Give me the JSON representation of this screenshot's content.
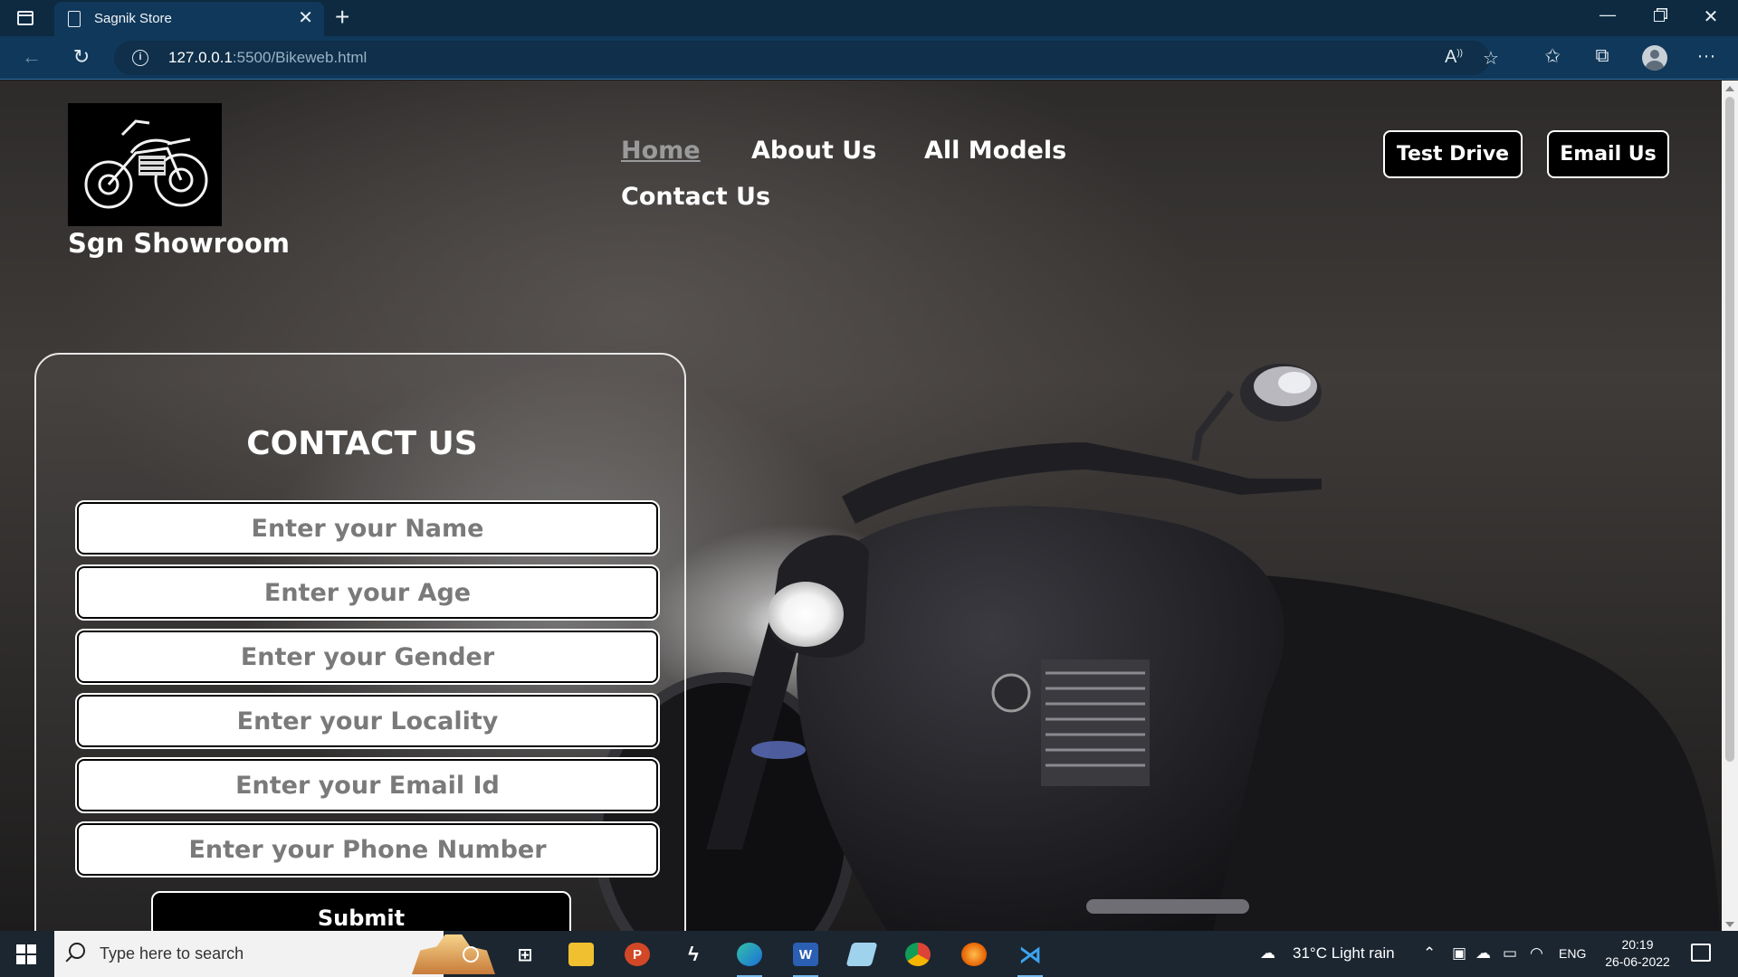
{
  "browser": {
    "tab_title": "Sagnik Store",
    "url_host": "127.0.0.1",
    "url_rest": ":5500/Bikeweb.html"
  },
  "site": {
    "brand": "Sgn Showroom",
    "nav": {
      "home": "Home",
      "about": "About Us",
      "models": "All Models",
      "contact": "Contact Us"
    },
    "buttons": {
      "test_drive": "Test Drive",
      "email_us": "Email Us"
    }
  },
  "form": {
    "title": "CONTACT US",
    "fields": {
      "name": "Enter your Name",
      "age": "Enter your Age",
      "gender": "Enter your Gender",
      "locality": "Enter your Locality",
      "email": "Enter your Email Id",
      "phone": "Enter your Phone Number"
    },
    "submit": "Submit"
  },
  "taskbar": {
    "search_placeholder": "Type here to search",
    "weather": "31°C  Light rain",
    "language": "ENG",
    "time": "20:19",
    "date": "26-06-2022"
  }
}
